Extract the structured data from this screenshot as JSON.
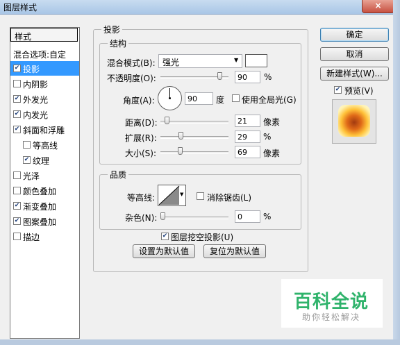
{
  "window": {
    "title": "图层样式",
    "close_glyph": "×"
  },
  "style_list": {
    "header": "样式",
    "items": [
      {
        "label": "混合选项:自定",
        "checkbox": false,
        "checked": false,
        "selected": false,
        "indent": false
      },
      {
        "label": "投影",
        "checkbox": true,
        "checked": true,
        "selected": true,
        "indent": false
      },
      {
        "label": "内阴影",
        "checkbox": true,
        "checked": false,
        "selected": false,
        "indent": false
      },
      {
        "label": "外发光",
        "checkbox": true,
        "checked": true,
        "selected": false,
        "indent": false
      },
      {
        "label": "内发光",
        "checkbox": true,
        "checked": true,
        "selected": false,
        "indent": false
      },
      {
        "label": "斜面和浮雕",
        "checkbox": true,
        "checked": true,
        "selected": false,
        "indent": false
      },
      {
        "label": "等高线",
        "checkbox": true,
        "checked": false,
        "selected": false,
        "indent": true
      },
      {
        "label": "纹理",
        "checkbox": true,
        "checked": true,
        "selected": false,
        "indent": true
      },
      {
        "label": "光泽",
        "checkbox": true,
        "checked": false,
        "selected": false,
        "indent": false
      },
      {
        "label": "颜色叠加",
        "checkbox": true,
        "checked": false,
        "selected": false,
        "indent": false
      },
      {
        "label": "渐变叠加",
        "checkbox": true,
        "checked": true,
        "selected": false,
        "indent": false
      },
      {
        "label": "图案叠加",
        "checkbox": true,
        "checked": true,
        "selected": false,
        "indent": false
      },
      {
        "label": "描边",
        "checkbox": true,
        "checked": false,
        "selected": false,
        "indent": false
      }
    ]
  },
  "panel": {
    "title": "投影",
    "structure": {
      "title": "结构",
      "blend_mode_label": "混合模式(B):",
      "blend_mode_value": "强光",
      "shadow_color": "#ffffff",
      "opacity_label": "不透明度(O):",
      "opacity_value": "90",
      "opacity_unit": "%",
      "opacity_level": 0.9,
      "angle_label": "角度(A):",
      "angle_value": "90",
      "angle_unit": "度",
      "global_light_label": "使用全局光(G)",
      "global_light_checked": false,
      "distance_label": "距离(D):",
      "distance_value": "21",
      "distance_unit": "像素",
      "distance_level": 0.07,
      "spread_label": "扩展(R):",
      "spread_value": "29",
      "spread_unit": "%",
      "spread_level": 0.29,
      "size_label": "大小(S):",
      "size_value": "69",
      "size_unit": "像素",
      "size_level": 0.28
    },
    "quality": {
      "title": "品质",
      "contour_label": "等高线:",
      "antialias_label": "消除锯齿(L)",
      "antialias_checked": false,
      "noise_label": "杂色(N):",
      "noise_value": "0",
      "noise_unit": "%",
      "noise_level": 0.0
    },
    "knockout_label": "图层挖空投影(U)",
    "knockout_checked": true,
    "set_default_label": "设置为默认值",
    "reset_default_label": "复位为默认值"
  },
  "buttons": {
    "ok": "确定",
    "cancel": "取消",
    "new_style": "新建样式(W)..."
  },
  "preview": {
    "label": "预览(V)",
    "checked": true
  },
  "watermark": {
    "brand": "百科全说",
    "tagline": "助你轻松解决",
    "brand_color": "#2fb36b"
  },
  "checkmark_glyph": "✔"
}
